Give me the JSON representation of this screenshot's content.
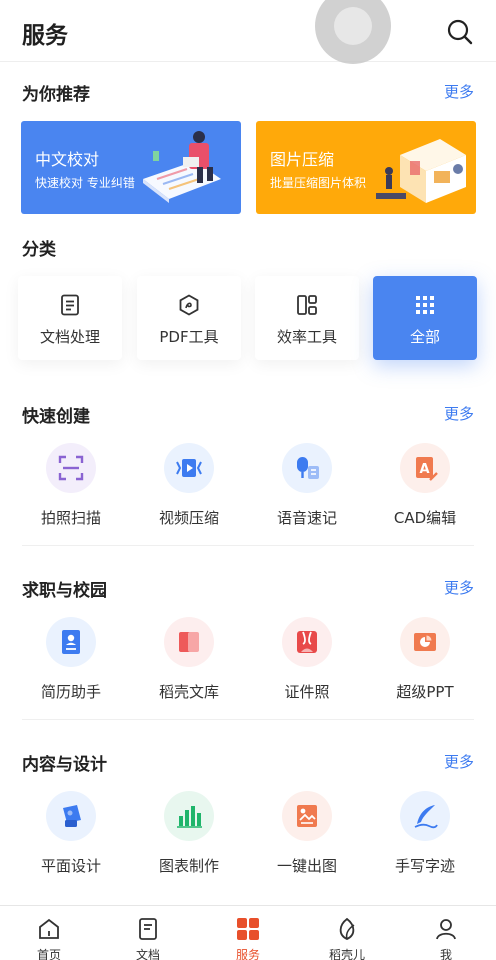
{
  "header": {
    "title": "服务"
  },
  "recommend": {
    "title": "为你推荐",
    "more": "更多",
    "cards": [
      {
        "title": "中文校对",
        "subtitle": "快速校对 专业纠错",
        "color": "#4a85f0"
      },
      {
        "title": "图片压缩",
        "subtitle": "批量压缩图片体积",
        "color": "#ffa90a"
      }
    ]
  },
  "categories": {
    "title": "分类",
    "items": [
      {
        "label": "文档处理",
        "icon": "document-icon"
      },
      {
        "label": "PDF工具",
        "icon": "pdf-icon"
      },
      {
        "label": "效率工具",
        "icon": "layout-icon"
      },
      {
        "label": "全部",
        "icon": "grid-dots-icon",
        "active": true
      }
    ]
  },
  "quick_create": {
    "title": "快速创建",
    "more": "更多",
    "items": [
      {
        "label": "拍照扫描",
        "icon": "scan-icon"
      },
      {
        "label": "视频压缩",
        "icon": "video-compress-icon"
      },
      {
        "label": "语音速记",
        "icon": "voice-note-icon"
      },
      {
        "label": "CAD编辑",
        "icon": "cad-edit-icon"
      }
    ]
  },
  "career": {
    "title": "求职与校园",
    "more": "更多",
    "items": [
      {
        "label": "简历助手",
        "icon": "resume-icon"
      },
      {
        "label": "稻壳文库",
        "icon": "library-icon"
      },
      {
        "label": "证件照",
        "icon": "id-photo-icon"
      },
      {
        "label": "超级PPT",
        "icon": "ppt-icon"
      }
    ]
  },
  "design": {
    "title": "内容与设计",
    "more": "更多",
    "items": [
      {
        "label": "平面设计",
        "icon": "graphic-design-icon"
      },
      {
        "label": "图表制作",
        "icon": "chart-make-icon"
      },
      {
        "label": "一键出图",
        "icon": "image-gen-icon"
      },
      {
        "label": "手写字迹",
        "icon": "handwriting-icon"
      }
    ]
  },
  "tabbar": {
    "items": [
      {
        "label": "首页",
        "icon": "home-icon"
      },
      {
        "label": "文档",
        "icon": "doc-tab-icon"
      },
      {
        "label": "服务",
        "icon": "service-icon",
        "active": true
      },
      {
        "label": "稻壳儿",
        "icon": "leaf-icon"
      },
      {
        "label": "我",
        "icon": "profile-icon"
      }
    ]
  }
}
